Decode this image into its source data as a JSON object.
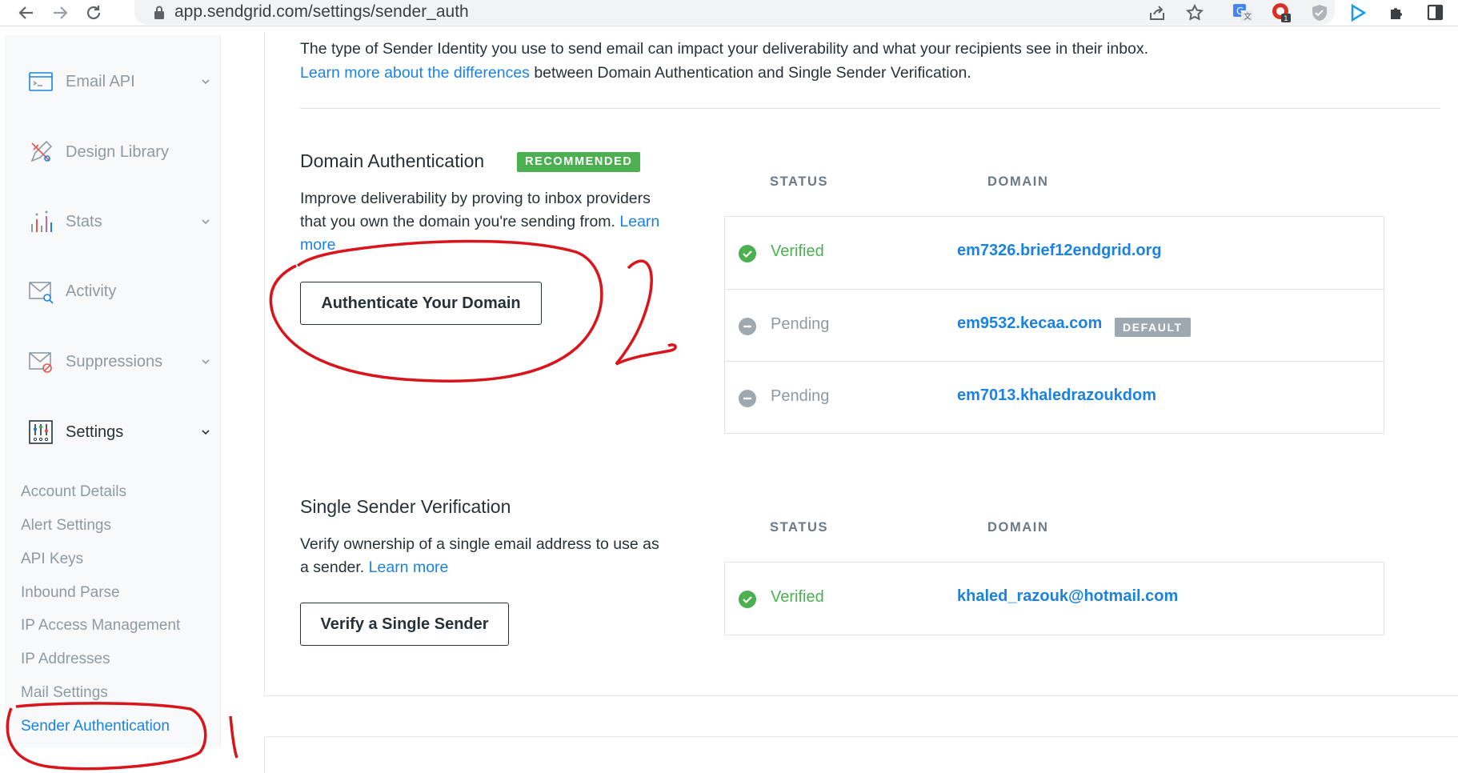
{
  "browser": {
    "url": "app.sendgrid.com/settings/sender_auth"
  },
  "sidebar": {
    "items": [
      {
        "label": "Email API"
      },
      {
        "label": "Design Library"
      },
      {
        "label": "Stats"
      },
      {
        "label": "Activity"
      },
      {
        "label": "Suppressions"
      },
      {
        "label": "Settings"
      }
    ],
    "settings_sub": [
      {
        "label": "Account Details"
      },
      {
        "label": "Alert Settings"
      },
      {
        "label": "API Keys"
      },
      {
        "label": "Inbound Parse"
      },
      {
        "label": "IP Access Management"
      },
      {
        "label": "IP Addresses"
      },
      {
        "label": "Mail Settings"
      },
      {
        "label": "Sender Authentication"
      }
    ]
  },
  "intro": {
    "text": "The type of Sender Identity you use to send email can impact your deliverability and what your recipients see in their inbox.",
    "link": "Learn more about the differences",
    "rest": " between Domain Authentication and Single Sender Verification."
  },
  "domain_auth": {
    "title": "Domain Authentication",
    "badge": "RECOMMENDED",
    "desc": "Improve deliverability by proving to inbox providers that you own the domain you're sending from.",
    "learn_more": "Learn more",
    "button": "Authenticate Your Domain",
    "status_header": "STATUS",
    "domain_header": "DOMAIN",
    "rows": [
      {
        "status": "Verified",
        "domain": "em7326.brief12endgrid.org",
        "badge": ""
      },
      {
        "status": "Pending",
        "domain": "em9532.kecaa.com",
        "badge": "DEFAULT"
      },
      {
        "status": "Pending",
        "domain": "em7013.khaledrazoukdom",
        "badge": ""
      }
    ]
  },
  "single_sender": {
    "title": "Single Sender Verification",
    "desc": "Verify ownership of a single email address to use as a sender.",
    "learn_more": "Learn more",
    "button": "Verify a Single Sender",
    "status_header": "STATUS",
    "domain_header": "DOMAIN",
    "rows": [
      {
        "status": "Verified",
        "domain": "khaled_razouk@hotmail.com"
      }
    ]
  },
  "annotations": {
    "mark_1": "1",
    "mark_2": "2"
  },
  "colors": {
    "link": "#1a82e2",
    "verified": "#4caf50",
    "pending": "#8e9aa3",
    "annotation": "#d9141b"
  }
}
